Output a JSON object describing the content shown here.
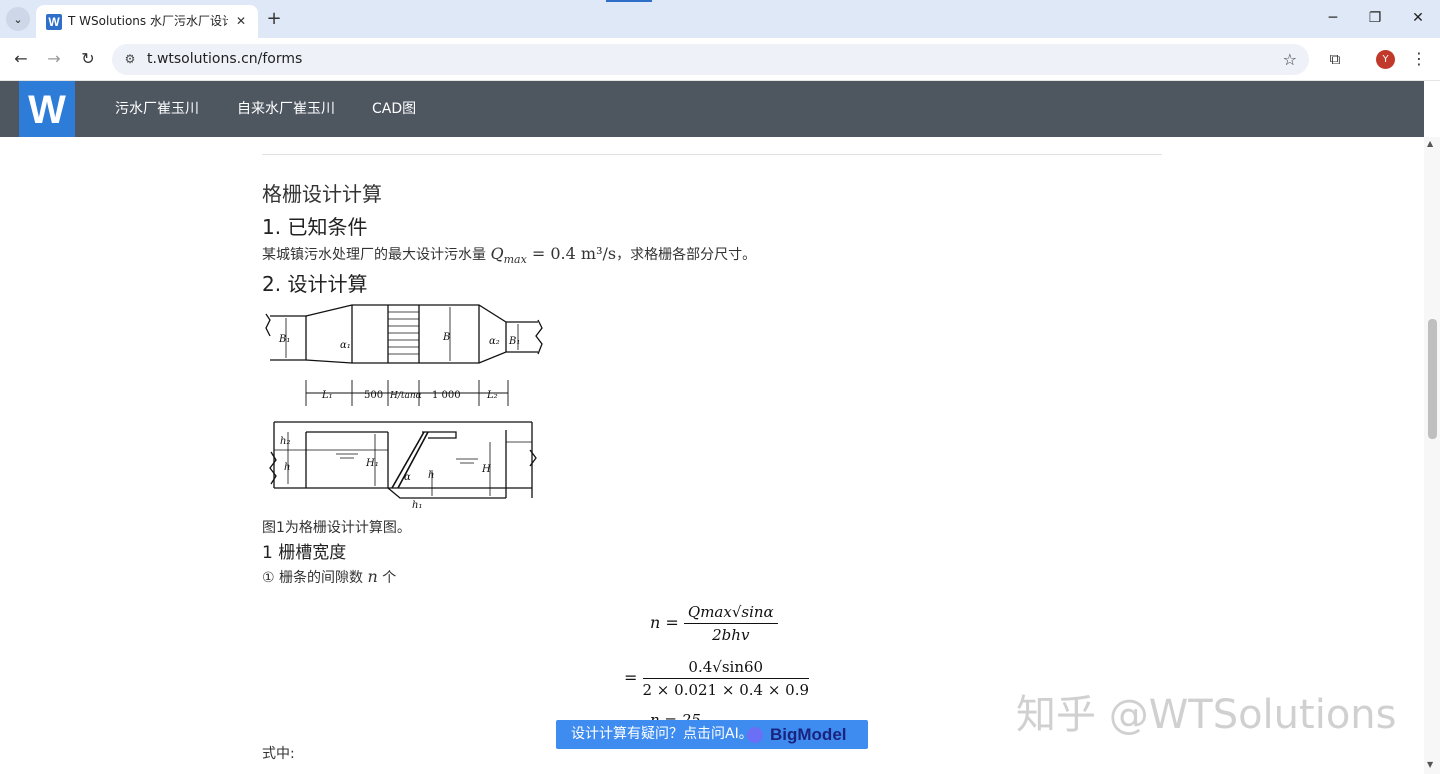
{
  "browser": {
    "tab_title": "T WSolutions 水厂污水厂设计",
    "favicon_letter": "W",
    "url": "t.wtsolutions.cn/forms",
    "profile_initial": "Y"
  },
  "site": {
    "logo_letter": "W",
    "nav": [
      "污水厂崔玉川",
      "自来水厂崔玉川",
      "CAD图"
    ]
  },
  "article": {
    "title": "格栅设计计算",
    "section1": "1. 已知条件",
    "condition_prefix": "某城镇污水处理厂的最大设计污水量",
    "condition_math": "Q",
    "condition_sub": "max",
    "condition_value": " = 0.4 m³/s",
    "condition_suffix": "，求格栅各部分尺寸。",
    "section2": "2. 设计计算",
    "figure_caption": "图1为格栅设计计算图。",
    "sub1": "1 栅槽宽度",
    "item1_prefix": "① 栅条的间隙数",
    "item1_var": "n",
    "item1_suffix": "个",
    "formula1_lhs": "n =",
    "formula1_num": "Qmax√sinα",
    "formula1_den": "2bhv",
    "formula2_lhs": "=",
    "formula2_num": "0.4√sin60",
    "formula2_den": "2 × 0.021 × 0.4 × 0.9",
    "formula3_partial": "n = 25",
    "where_label": "式中:"
  },
  "figure_labels": {
    "b1": "B₁",
    "b": "B",
    "alpha1": "α₁",
    "alpha2": "α₂",
    "l1": "L₁",
    "d500": "500",
    "h_tan": "H/tanα",
    "d1000": "1 000",
    "l2": "L₂",
    "h2": "h₂",
    "h": "h",
    "h1": "H₁",
    "alpha": "α",
    "hh": "h",
    "H": "H",
    "h1b": "h₁"
  },
  "ai_banner": {
    "text": "设计计算有疑问？点击问AI。",
    "brand": "BigModel"
  },
  "watermark": "知乎 @WTSolutions",
  "icons": {
    "tab_list": "chevron-down-icon",
    "new_tab": "plus-icon",
    "back": "arrow-left-icon",
    "forward": "arrow-right-icon",
    "reload": "reload-icon",
    "bookmark": "star-icon",
    "extensions": "puzzle-icon",
    "menu": "kebab-icon"
  }
}
